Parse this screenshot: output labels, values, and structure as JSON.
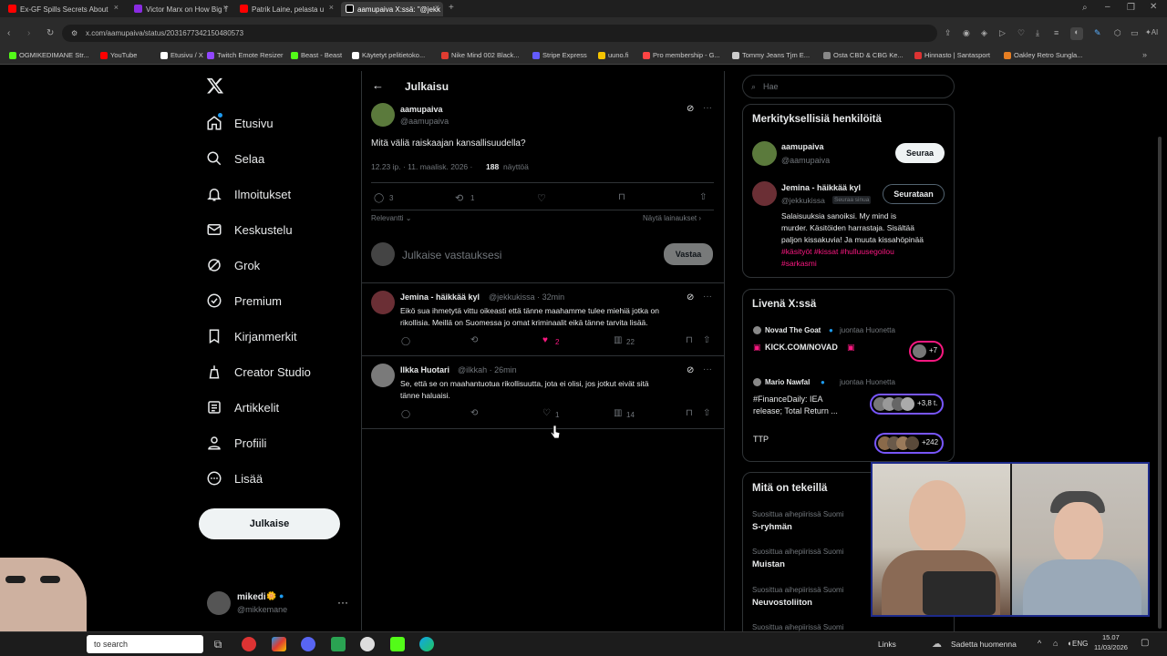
{
  "browser": {
    "tabs": [
      {
        "label": "Ex-GF Spills Secrets About",
        "color": "#ff0000"
      },
      {
        "label": "Victor Marx on How Big T",
        "color": "#8a2be2"
      },
      {
        "label": "Patrik Laine, pelasta u",
        "color": "#ff0000"
      },
      {
        "label": "aamupaiva X:ssä: \"@jekk",
        "color": "#ffffff"
      }
    ],
    "url": "x.com/aamupaiva/status/2031677342150480573",
    "bookmarks": [
      {
        "label": "OGMIKEDIMANE Str...",
        "color": "#53fc18"
      },
      {
        "label": "YouTube",
        "color": "#ff0000"
      },
      {
        "label": "Etusivu / X",
        "color": "#ffffff"
      },
      {
        "label": "Twitch Emote Resizer",
        "color": "#9146ff"
      },
      {
        "label": "Beast - Beast",
        "color": "#53fc18"
      },
      {
        "label": "Käytetyt pelitietoko...",
        "color": "#ffffff"
      },
      {
        "label": "Nike Mind 002 Black...",
        "color": "#e03c31"
      },
      {
        "label": "Stripe Express",
        "color": "#635bff"
      },
      {
        "label": "uuno.fi",
        "color": "#f5c400"
      },
      {
        "label": "Pro membership - G...",
        "color": "#ff4444"
      },
      {
        "label": "Tommy Jeans Tjm E...",
        "color": "#cccccc"
      },
      {
        "label": "Osta CBD & CBG Ke...",
        "color": "#888888"
      },
      {
        "label": "Hinnasto | Santasport",
        "color": "#d33"
      },
      {
        "label": "Oakley Retro Sungla...",
        "color": "#e67e22"
      }
    ]
  },
  "nav": {
    "items": [
      {
        "label": "Etusivu",
        "icon": "home-icon"
      },
      {
        "label": "Selaa",
        "icon": "search-icon"
      },
      {
        "label": "Ilmoitukset",
        "icon": "bell-icon"
      },
      {
        "label": "Keskustelu",
        "icon": "mail-icon"
      },
      {
        "label": "Grok",
        "icon": "grok-icon"
      },
      {
        "label": "Premium",
        "icon": "verified-icon"
      },
      {
        "label": "Kirjanmerkit",
        "icon": "bookmark-icon"
      },
      {
        "label": "Creator Studio",
        "icon": "creator-icon"
      },
      {
        "label": "Artikkelit",
        "icon": "articles-icon"
      },
      {
        "label": "Profiili",
        "icon": "person-icon"
      },
      {
        "label": "Lisää",
        "icon": "more-circle-icon"
      }
    ],
    "post_label": "Julkaise",
    "account": {
      "name": "mikedi",
      "handle": "@mikkemane"
    }
  },
  "main": {
    "header": "Julkaisu",
    "post": {
      "author": "aamupaiva",
      "handle": "@aamupaiva",
      "text": "Mitä väliä raiskaajan kansallisuudella?",
      "time": "12.23 ip. · 11. maalisk. 2026 ·",
      "views_count": "188",
      "views_label": "näyttöä",
      "replies": "3",
      "reposts": "1",
      "sort_label": "Relevantti",
      "quotes_label": "Näytä lainaukset"
    },
    "reply_box": {
      "placeholder": "Julkaise vastauksesi",
      "button": "Vastaa"
    },
    "replies": [
      {
        "author": "Jemina - häikkää kyl",
        "meta": "@jekkukissa · 32min",
        "text1": "Eikö sua ihmetytä vittu oikeasti että tänne maahamme tulee miehiä jotka on",
        "text2": "rikollisia. Meillä on Suomessa jo omat kriminaalit eikä tänne tarvita lisää.",
        "likes": "2",
        "views": "22"
      },
      {
        "author": "Ilkka Huotari",
        "meta": "@ilkkah · 26min",
        "text1": "Se, että se on maahantuotua rikollisuutta, jota ei olisi, jos jotkut eivät sitä",
        "text2": "tänne haluaisi.",
        "likes": "1",
        "views": "14"
      }
    ]
  },
  "sidebar": {
    "search_placeholder": "Hae",
    "relevant": {
      "title": "Merkityksellisiä henkilöitä",
      "people": [
        {
          "name": "aamupaiva",
          "handle": "@aamupaiva",
          "button": "Seuraa"
        },
        {
          "name": "Jemina - häikkää kyl",
          "handle": "@jekkukissa",
          "badge": "Seuraa sinua",
          "button": "Seurataan",
          "bio1": "Salaisuuksia sanoiksi. My mind is",
          "bio2": "murder. Käsitöiden harrastaja. Sisältää",
          "bio3": "paljon kissakuvia! Ja muuta kissahöpinää",
          "tags1": "#käsityöt #kissat #hulluusegoilou",
          "tags2": "#sarkasmi"
        }
      ]
    },
    "live": {
      "title": "Livenä X:ssä",
      "items": [
        {
          "host": "Novad The Goat",
          "sub": "juontaa Huonetta",
          "title1": "KICK.COM/NOVAD",
          "title2": "",
          "count": "+7"
        },
        {
          "host": "Mario Nawfal",
          "sub": "juontaa Huonetta",
          "title1": "#FinanceDaily: IEA",
          "title2": "release; Total Return ...",
          "count": "+3,8 t."
        },
        {
          "host": "",
          "sub": "",
          "title1": "TTP",
          "title2": "",
          "count": "+242"
        }
      ]
    },
    "trends": {
      "title": "Mitä on tekeillä",
      "items": [
        {
          "context": "Suosittua aihepiirissä Suomi",
          "name": "S-ryhmän"
        },
        {
          "context": "Suosittua aihepiirissä Suomi",
          "name": "Muistan"
        },
        {
          "context": "Suosittua aihepiirissä Suomi",
          "name": "Neuvostoliiton"
        },
        {
          "context": "Suosittua aihepiirissä Suomi",
          "name": ""
        }
      ]
    }
  },
  "taskbar": {
    "search": "to search",
    "links": "Links",
    "weather": "Sadetta huomenna",
    "lang": "ENG",
    "time": "15.07",
    "date": "11/03/2026"
  },
  "colors": {
    "like_pink": "#f91880",
    "accent_blue": "#1d9bf0",
    "hashtag_pink": "#f91880"
  }
}
